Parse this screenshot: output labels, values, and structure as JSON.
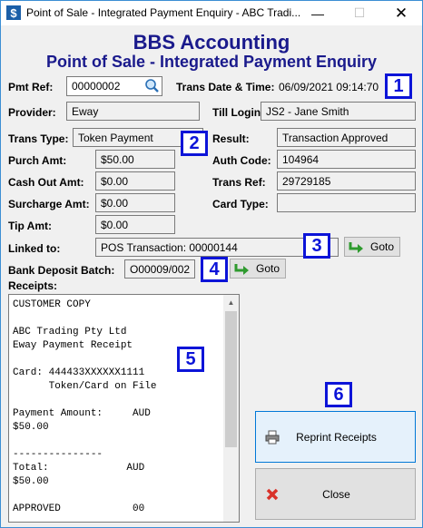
{
  "window": {
    "title": "Point of Sale - Integrated Payment Enquiry - ABC Tradi...",
    "minimize": "—",
    "maximize": "☐",
    "close": "✕"
  },
  "header": {
    "app_name": "BBS Accounting",
    "subtitle": "Point of Sale - Integrated Payment Enquiry"
  },
  "form": {
    "pmt_ref_label": "Pmt Ref:",
    "pmt_ref_value": "00000002",
    "trans_date_label": "Trans Date & Time:",
    "trans_date_value": "06/09/2021 09:14:70",
    "provider_label": "Provider:",
    "provider_value": "Eway",
    "till_login_label": "Till Login:",
    "till_login_value": "JS2 - Jane Smith",
    "trans_type_label": "Trans Type:",
    "trans_type_value": "Token Payment",
    "result_label": "Result:",
    "result_value": "Transaction Approved",
    "purch_amt_label": "Purch Amt:",
    "purch_amt_value": "$50.00",
    "auth_code_label": "Auth Code:",
    "auth_code_value": "104964",
    "cash_out_label": "Cash Out Amt:",
    "cash_out_value": "$0.00",
    "trans_ref_label": "Trans Ref:",
    "trans_ref_value": "29729185",
    "surcharge_label": "Surcharge Amt:",
    "surcharge_value": "$0.00",
    "card_type_label": "Card Type:",
    "card_type_value": "",
    "tip_amt_label": "Tip Amt:",
    "tip_amt_value": "$0.00",
    "linked_to_label": "Linked to:",
    "linked_to_value": "POS Transaction: 00000144",
    "bank_deposit_label": "Bank Deposit Batch:",
    "bank_deposit_value": "O00009/002",
    "receipts_label": "Receipts:"
  },
  "buttons": {
    "goto_label": "Goto",
    "reprint_label": "Reprint Receipts",
    "close_label": "Close"
  },
  "receipt_lines": [
    "CUSTOMER COPY",
    "",
    "ABC Trading Pty Ltd",
    "Eway Payment Receipt",
    "",
    "Card: 444433XXXXXX1111",
    "      Token/Card on File",
    "",
    "Payment Amount:     AUD",
    "$50.00",
    "",
    "---------------",
    "Total:             AUD",
    "$50.00",
    "",
    "APPROVED            00"
  ],
  "badges": [
    "1",
    "2",
    "3",
    "4",
    "5",
    "6"
  ],
  "colors": {
    "heading": "#1a1a8c",
    "badge": "#0c14d8",
    "window_border": "#3c8ed4"
  }
}
